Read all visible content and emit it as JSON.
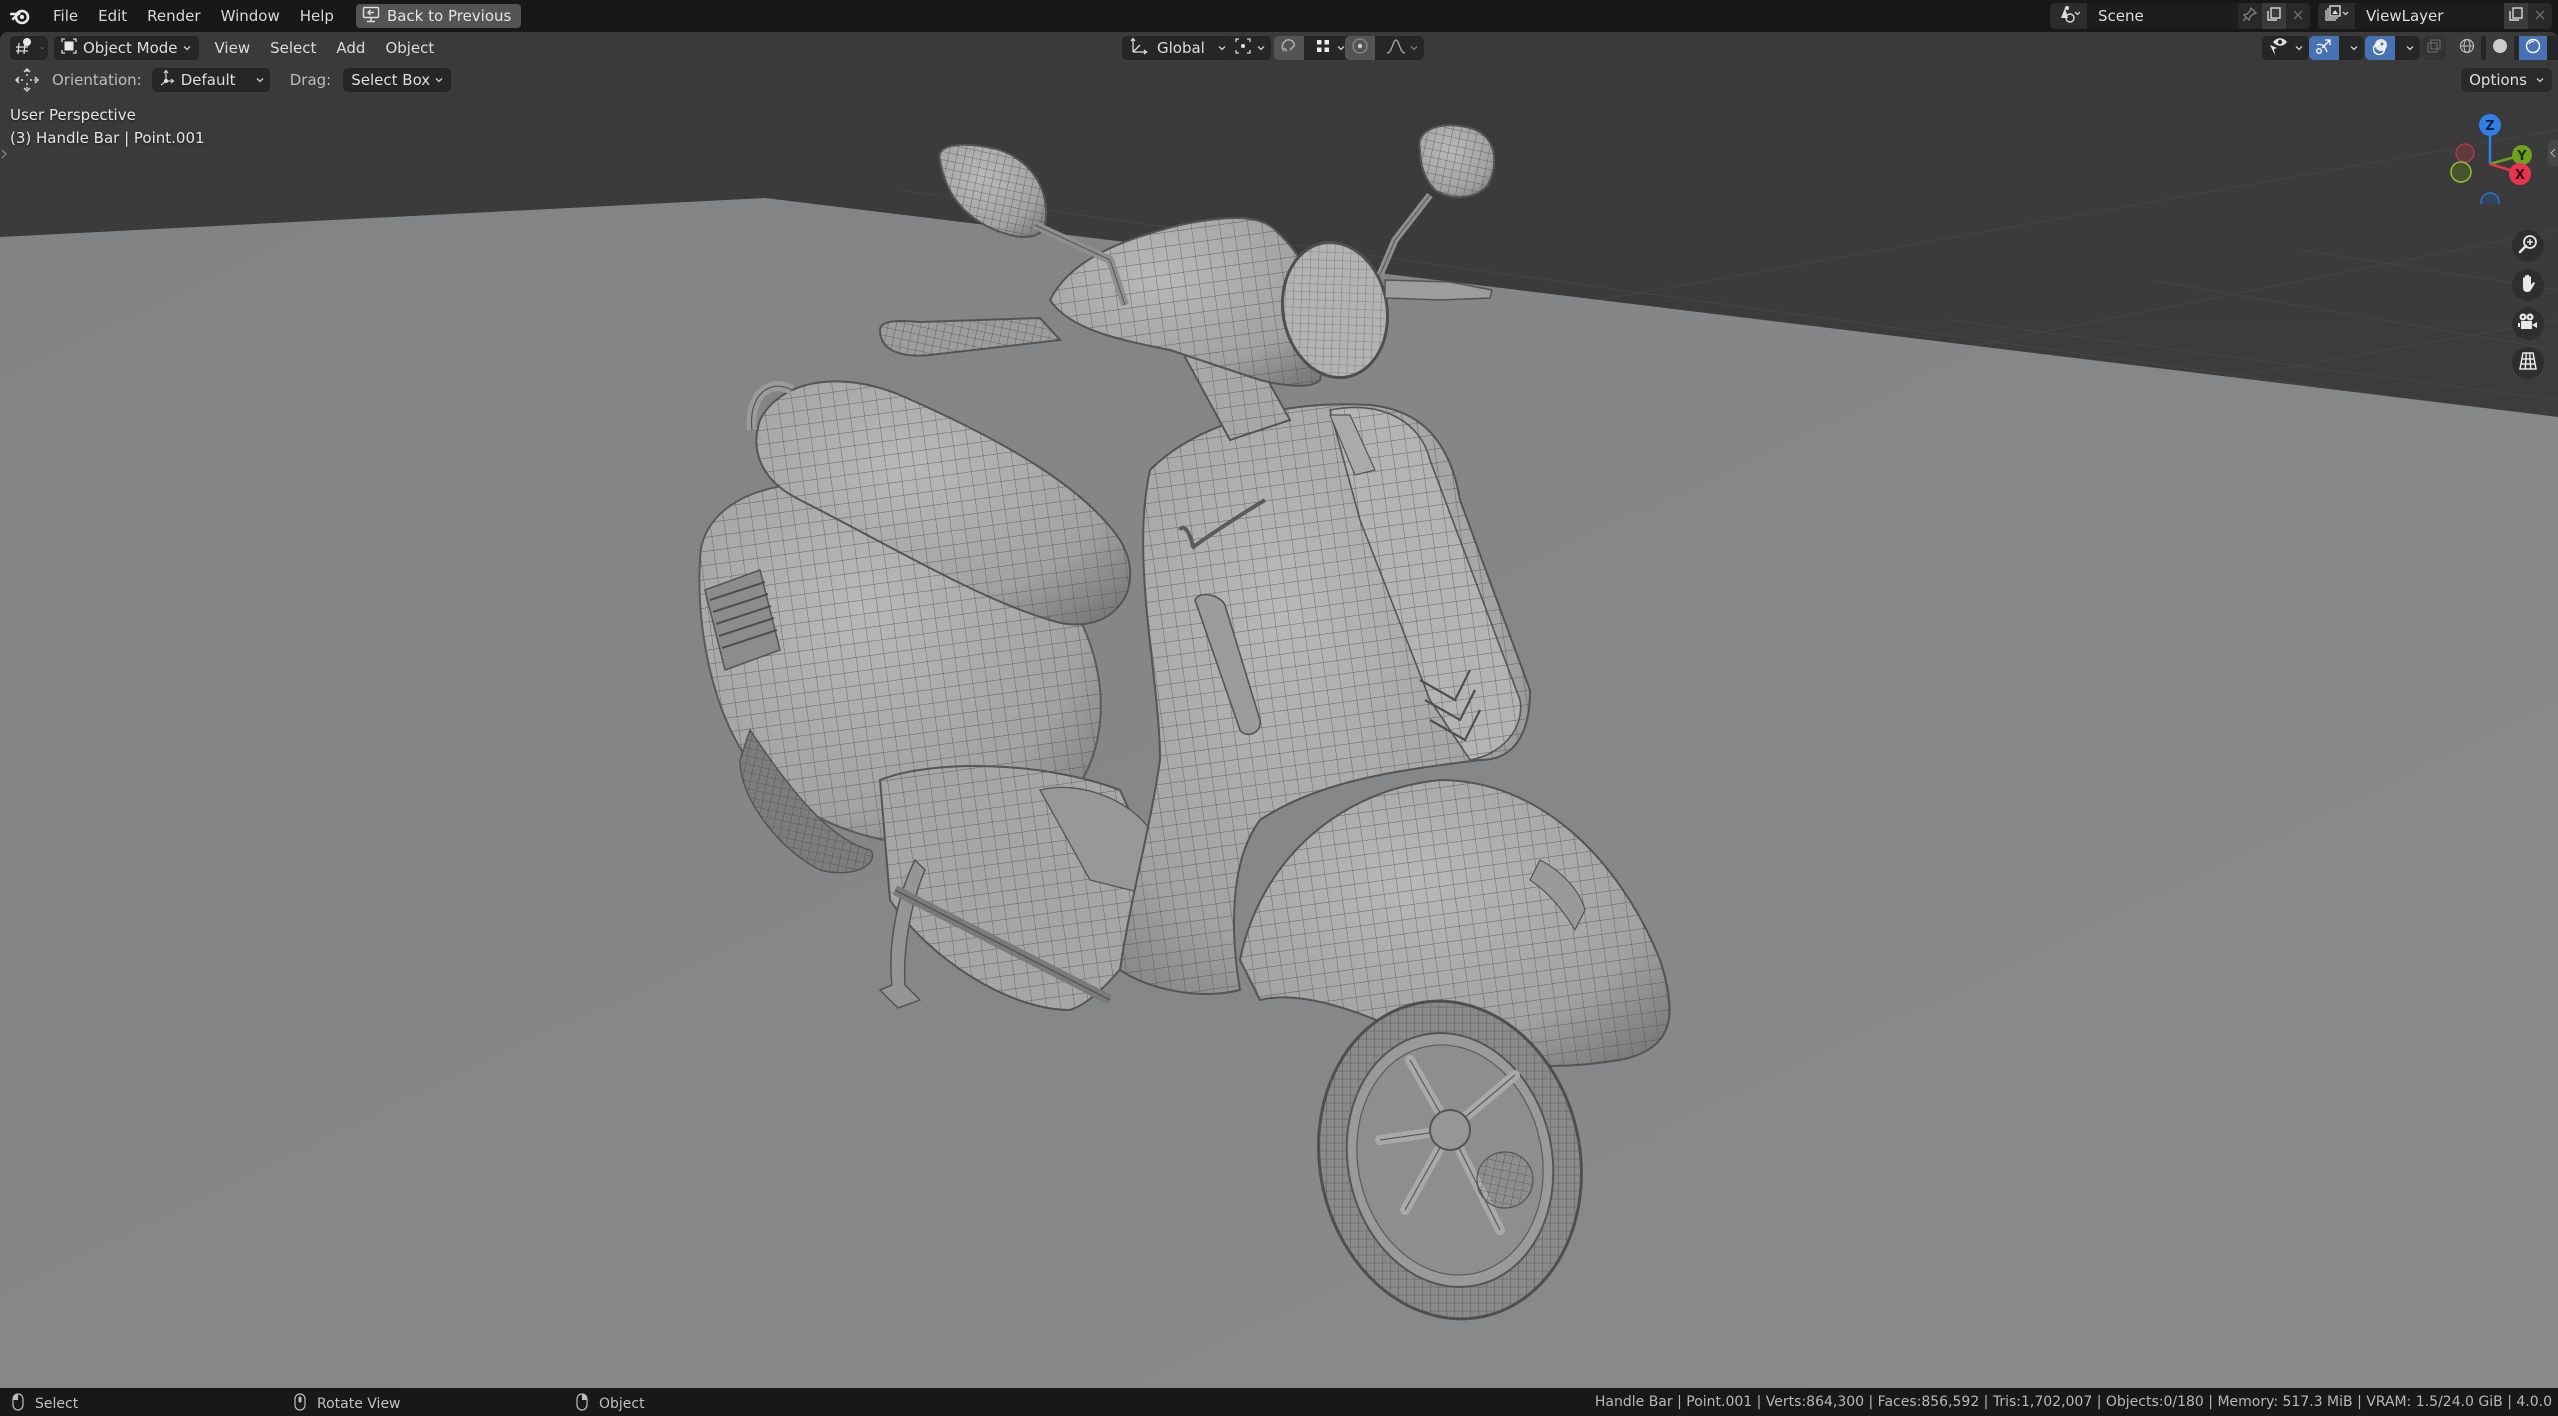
{
  "menubar": {
    "items": [
      "File",
      "Edit",
      "Render",
      "Window",
      "Help"
    ],
    "back_button": "Back to Previous",
    "scene": {
      "name": "Scene"
    },
    "view_layer": {
      "name": "ViewLayer"
    }
  },
  "header": {
    "mode": "Object Mode",
    "menus": [
      "View",
      "Select",
      "Add",
      "Object"
    ],
    "transform_orientation": "Global",
    "shading_mode_active": "solid",
    "colors": {
      "accent_blue": "#4772b3",
      "menubar_bg": "#181818",
      "viewport_bg": "#3d3d3d",
      "floor": "#858687"
    }
  },
  "tool_settings": {
    "orientation_label": "Orientation:",
    "orientation_value": "Default",
    "drag_label": "Drag:",
    "drag_value": "Select Box",
    "options_label": "Options"
  },
  "viewport": {
    "view_name": "User Perspective",
    "object_info": "(3) Handle Bar | Point.001",
    "gizmo_axes": [
      {
        "label": "Z",
        "color": "#2f7fe6"
      },
      {
        "label": "Y",
        "color": "#6ea11f"
      },
      {
        "label": "X",
        "color": "#e8344f"
      }
    ],
    "nav_buttons": [
      "zoom",
      "pan",
      "camera",
      "ortho-toggle"
    ]
  },
  "statusbar": {
    "hints": [
      {
        "icon": "mouse-left-icon",
        "label": "Select"
      },
      {
        "icon": "mouse-middle-icon",
        "label": "Rotate View"
      },
      {
        "icon": "mouse-right-icon",
        "label": "Object"
      }
    ],
    "stats": "Handle Bar | Point.001 | Verts:864,300 | Faces:856,592 | Tris:1,702,007 | Objects:0/180 | Memory: 517.3 MiB | VRAM: 1.5/24.0 GiB | 4.0.0"
  }
}
